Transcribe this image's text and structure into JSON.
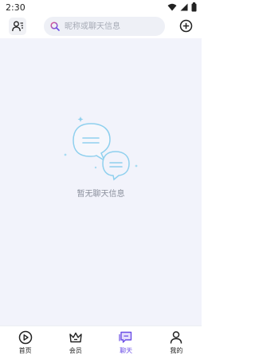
{
  "status_bar": {
    "time": "2:30",
    "icons": [
      "wifi-icon",
      "signal-icon",
      "battery-icon"
    ]
  },
  "header": {
    "contacts_icon": "contacts-icon",
    "search_placeholder": "昵称或聊天信息",
    "add_icon": "add-circle-icon"
  },
  "empty_state": {
    "text": "暂无聊天信息"
  },
  "bottom_nav": {
    "items": [
      {
        "label": "首页",
        "icon": "play-circle-icon",
        "active": false
      },
      {
        "label": "会员",
        "icon": "crown-icon",
        "active": false
      },
      {
        "label": "聊天",
        "icon": "chat-icon",
        "active": true
      },
      {
        "label": "我的",
        "icon": "person-icon",
        "active": false
      }
    ]
  },
  "colors": {
    "accent": "#6b4ee6",
    "content_bg": "#f2f3fb",
    "illustration": "#8fd0ee",
    "search_bg": "#eef0f6"
  }
}
